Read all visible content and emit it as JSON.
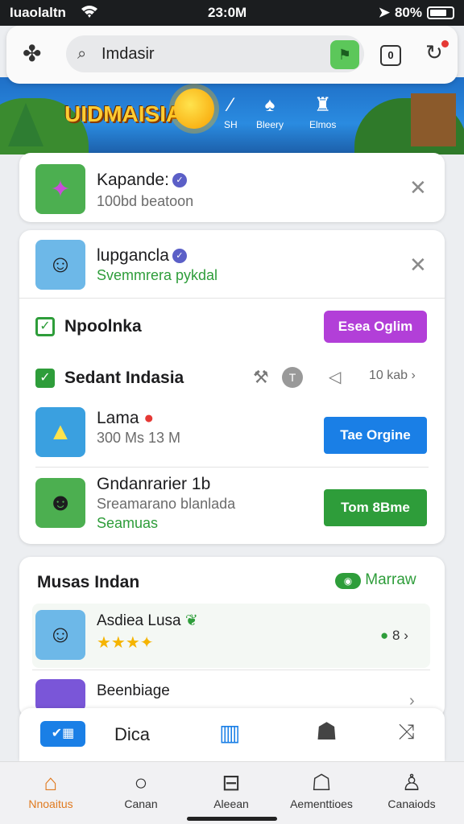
{
  "status_bar": {
    "carrier": "Iuaolaltn",
    "time": "23:0M",
    "battery": "80%"
  },
  "search": {
    "value": "Imdasir"
  },
  "tabs_count": "0",
  "banner": {
    "logo": "UIDMAISIA",
    "nav": [
      {
        "label": "SH"
      },
      {
        "label": "Bleery"
      },
      {
        "label": "Elmos"
      }
    ]
  },
  "card1": {
    "title": "Kapande:",
    "subtitle": "100bd beatoon"
  },
  "card2": {
    "item": {
      "title": "lupgancla",
      "subtitle": "Svemmrera pykdal"
    },
    "row1": {
      "label": "Npoolnka",
      "button": "Esea Oglim"
    },
    "row2": {
      "label": "Sedant Indasia",
      "count": "10 kab"
    },
    "apps": [
      {
        "title": "Lama",
        "subtitle": "300 Ms 13 M",
        "button": "Tae Orgine",
        "button_color": "#1a7fe6"
      },
      {
        "title": "Gndanrarier 1b",
        "subtitle": "Sreamarano blanlada",
        "extra": "Seamuas",
        "button": "Tom 8Bme",
        "button_color": "#2e9d3a"
      }
    ]
  },
  "card3": {
    "heading": "Musas Indan",
    "more_label": "Marraw",
    "items": [
      {
        "title": "Asdiea Lusa",
        "count": "8"
      },
      {
        "title": "Beenbiage"
      }
    ]
  },
  "toolbar": {
    "label": "Dica"
  },
  "tabbar": [
    {
      "label": "Nnoaitus",
      "active": true
    },
    {
      "label": "Canan"
    },
    {
      "label": "Aleean"
    },
    {
      "label": "Aementtioes"
    },
    {
      "label": "Canaiods"
    }
  ],
  "colors": {
    "accent": "#e07a1f",
    "green": "#2e9d3a",
    "blue": "#1a7fe6",
    "purple": "#b23fd8"
  }
}
